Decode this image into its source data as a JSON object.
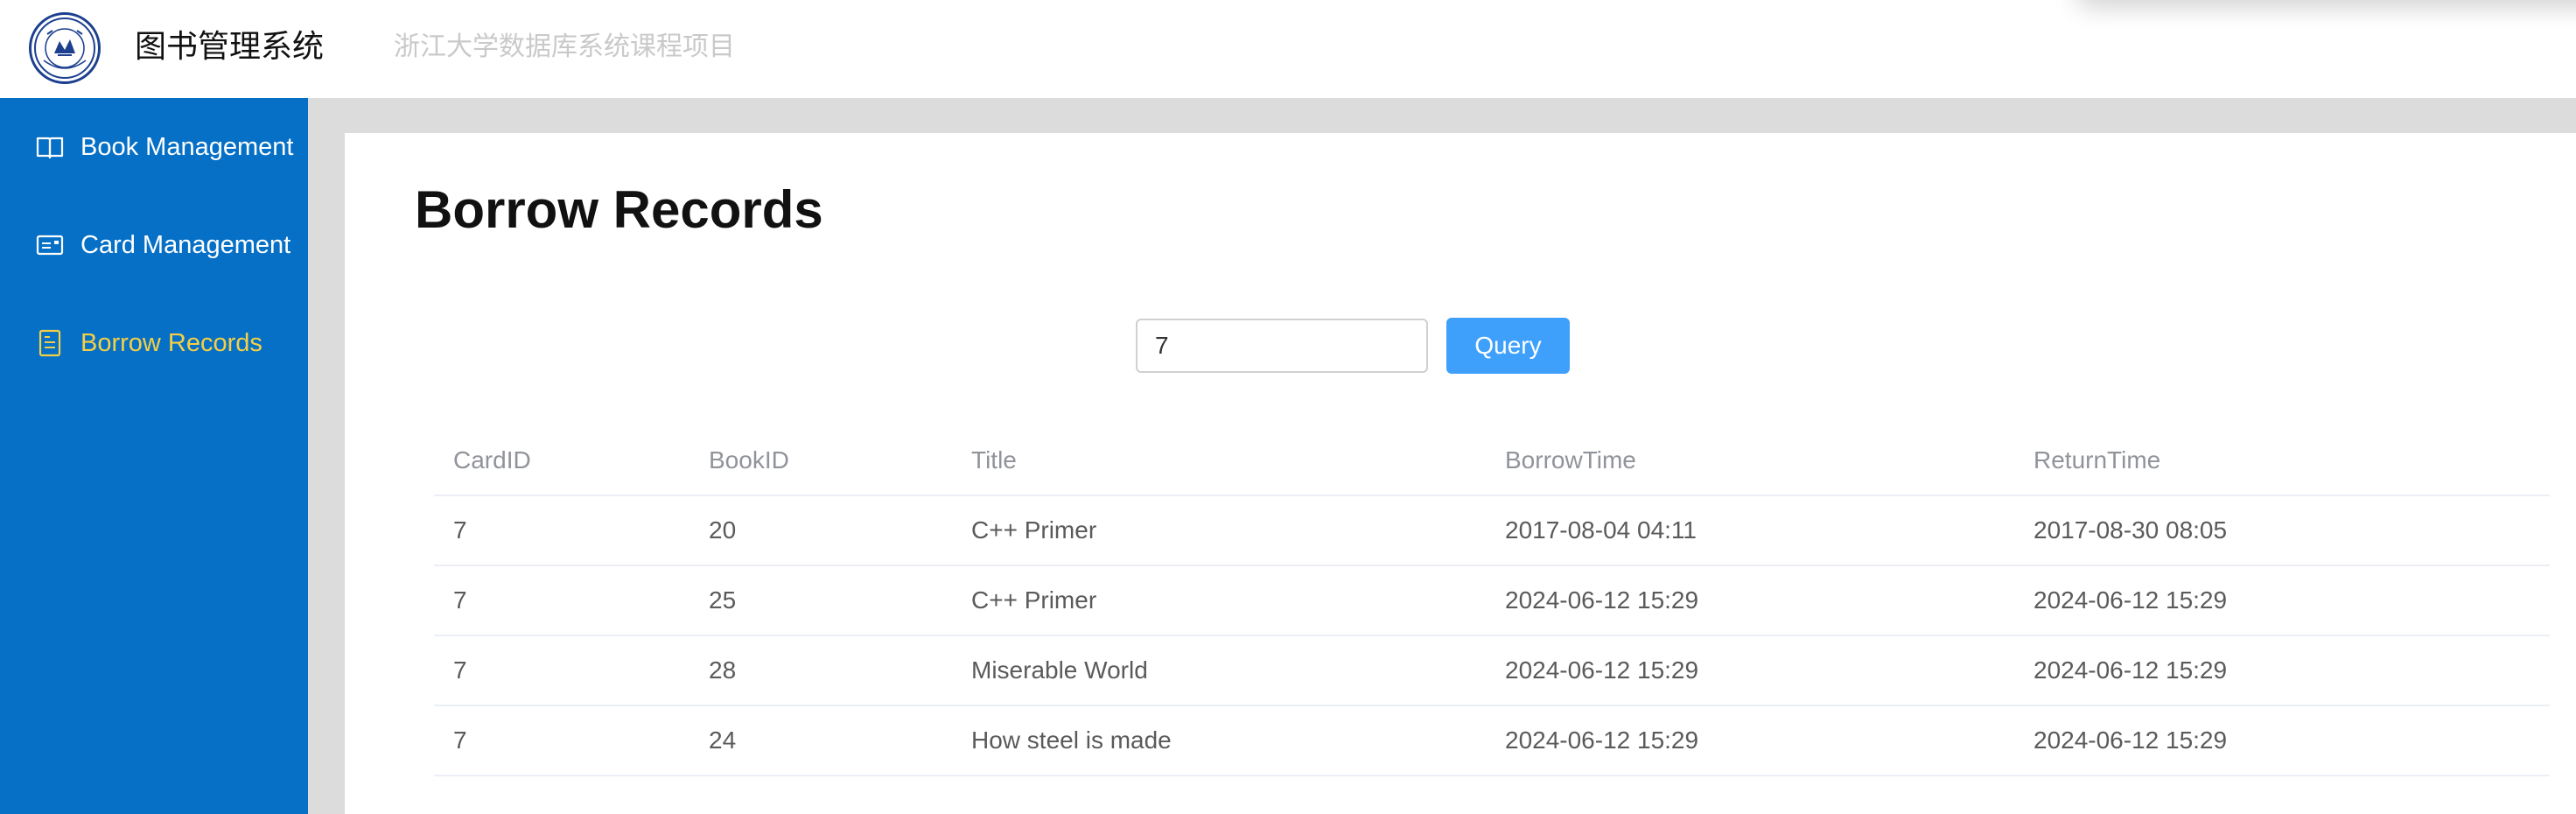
{
  "header": {
    "app_title": "图书管理系统",
    "subtitle": "浙江大学数据库系统课程项目",
    "logo_icon": "university-seal-icon"
  },
  "sidebar": {
    "items": [
      {
        "label": "Book Management",
        "icon": "book-open-icon",
        "active": false
      },
      {
        "label": "Card Management",
        "icon": "id-card-icon",
        "active": false
      },
      {
        "label": "Borrow Records",
        "icon": "document-list-icon",
        "active": true
      }
    ],
    "active_color": "#f5cf45",
    "background_color": "#0570c6"
  },
  "main": {
    "title": "Borrow Records",
    "query": {
      "value": "7",
      "button_label": "Query",
      "button_color": "#3fa0fc"
    },
    "table": {
      "columns": [
        "CardID",
        "BookID",
        "Title",
        "BorrowTime",
        "ReturnTime"
      ],
      "rows": [
        [
          "7",
          "20",
          "C++ Primer",
          "2017-08-04 04:11",
          "2017-08-30 08:05"
        ],
        [
          "7",
          "25",
          "C++ Primer",
          "2024-06-12 15:29",
          "2024-06-12 15:29"
        ],
        [
          "7",
          "28",
          "Miserable World",
          "2024-06-12 15:29",
          "2024-06-12 15:29"
        ],
        [
          "7",
          "24",
          "How steel is made",
          "2024-06-12 15:29",
          "2024-06-12 15:29"
        ]
      ]
    }
  }
}
